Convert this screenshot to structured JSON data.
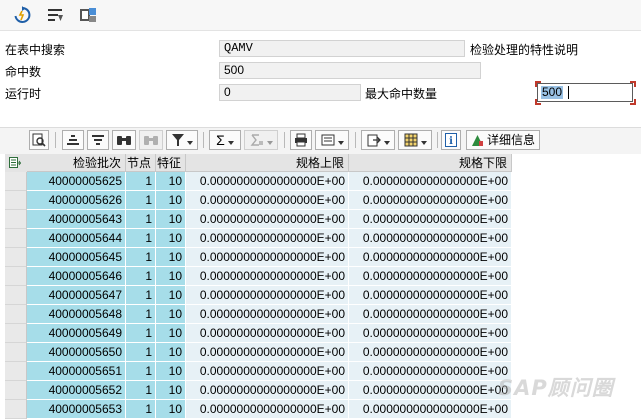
{
  "toolbar": {
    "icons": [
      "refresh-icon",
      "filter-settings-icon",
      "layout-icon"
    ]
  },
  "form": {
    "search_label": "在表中搜索",
    "search_value": "QAMV",
    "search_desc": "检验处理的特性说明",
    "hits_label": "命中数",
    "hits_value": "500",
    "runtime_label": "运行时",
    "runtime_value": "0",
    "max_hits_label": "最大命中数量",
    "max_hits_value": "500"
  },
  "alv_toolbar": {
    "details_label": "详细信息",
    "sum_symbol": "Σ"
  },
  "table": {
    "columns": [
      "检验批次",
      "节点",
      "特征",
      "规格上限",
      "规格下限"
    ],
    "rows": [
      [
        "40000005625",
        "1",
        "10",
        "0.0000000000000000E+00",
        "0.0000000000000000E+00"
      ],
      [
        "40000005626",
        "1",
        "10",
        "0.0000000000000000E+00",
        "0.0000000000000000E+00"
      ],
      [
        "40000005643",
        "1",
        "10",
        "0.0000000000000000E+00",
        "0.0000000000000000E+00"
      ],
      [
        "40000005644",
        "1",
        "10",
        "0.0000000000000000E+00",
        "0.0000000000000000E+00"
      ],
      [
        "40000005645",
        "1",
        "10",
        "0.0000000000000000E+00",
        "0.0000000000000000E+00"
      ],
      [
        "40000005646",
        "1",
        "10",
        "0.0000000000000000E+00",
        "0.0000000000000000E+00"
      ],
      [
        "40000005647",
        "1",
        "10",
        "0.0000000000000000E+00",
        "0.0000000000000000E+00"
      ],
      [
        "40000005648",
        "1",
        "10",
        "0.0000000000000000E+00",
        "0.0000000000000000E+00"
      ],
      [
        "40000005649",
        "1",
        "10",
        "0.0000000000000000E+00",
        "0.0000000000000000E+00"
      ],
      [
        "40000005650",
        "1",
        "10",
        "0.0000000000000000E+00",
        "0.0000000000000000E+00"
      ],
      [
        "40000005651",
        "1",
        "10",
        "0.0000000000000000E+00",
        "0.0000000000000000E+00"
      ],
      [
        "40000005652",
        "1",
        "10",
        "0.0000000000000000E+00",
        "0.0000000000000000E+00"
      ],
      [
        "40000005653",
        "1",
        "10",
        "0.0000000000000000E+00",
        "0.0000000000000000E+00"
      ]
    ]
  },
  "watermark": "SAP顾问圈",
  "colors": {
    "key_cell": "#a6dde9",
    "value_cell": "#e7f1f6",
    "header": "#e4e4e4"
  }
}
